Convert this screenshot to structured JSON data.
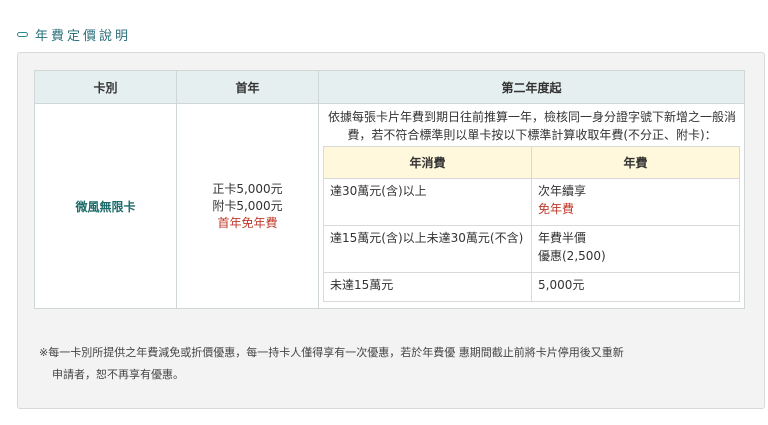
{
  "section": {
    "title": "年費定價說明",
    "icon": "dash-icon"
  },
  "table": {
    "headers": {
      "card_type": "卡別",
      "first_year": "首年",
      "second_year": "第二年度起"
    },
    "card_name": "微風無限卡",
    "first_year": {
      "primary": "正卡5,000元",
      "supplementary": "附卡5,000元",
      "waiver": "首年免年費"
    },
    "description": "依據每張卡片年費到期日往前推算一年，檢核同一身分證字號下新增之一般消費，若不符合標準則以單卡按以下標準計算收取年費(不分正、附卡)：",
    "inner": {
      "headers": {
        "spend": "年消費",
        "fee": "年費"
      },
      "rows": [
        {
          "spend": "達30萬元(含)以上",
          "fee": "次年續享",
          "fee_note": "免年費"
        },
        {
          "spend": "達15萬元(含)以上未達30萬元(不含)",
          "fee": "年費半價",
          "fee_note": "優惠(2,500)"
        },
        {
          "spend": "未達15萬元",
          "fee": "5,000元",
          "fee_note": ""
        }
      ]
    }
  },
  "note": {
    "line1": "※每一卡別所提供之年費減免或折價優惠，每一持卡人僅得享有一次優惠，若於年費優 惠期間截止前將卡片停用後又重新",
    "line2": "申請者，恕不再享有優惠。"
  },
  "colors": {
    "accent": "#2a8c8c",
    "header_bg": "#e6efef",
    "inner_header_bg": "#fff8dc",
    "highlight_red": "#c0392b"
  }
}
